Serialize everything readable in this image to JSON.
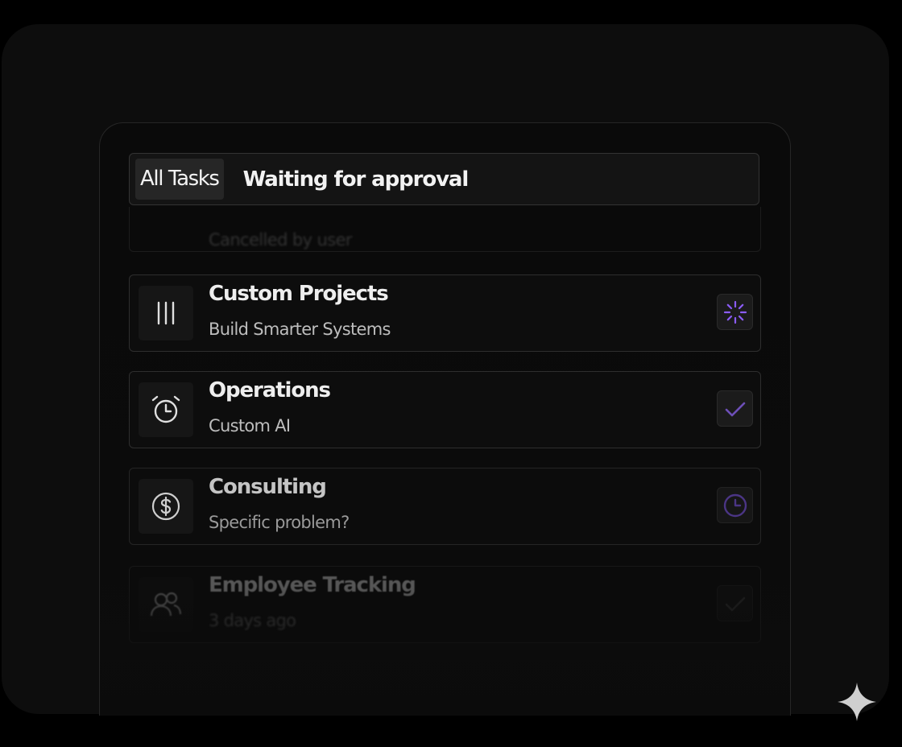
{
  "tabs": {
    "all_label": "All Tasks",
    "waiting_label": "Waiting for approval"
  },
  "ghost_card": {
    "subtitle": "Cancelled by user"
  },
  "cards": [
    {
      "title": "Custom Projects",
      "subtitle": "Build Smarter Systems",
      "icon": "columns-icon",
      "status": "loading-spinner-icon"
    },
    {
      "title": "Operations",
      "subtitle": "Custom AI",
      "icon": "alarm-clock-icon",
      "status": "checkmark-icon"
    },
    {
      "title": "Consulting",
      "subtitle": "Specific problem?",
      "icon": "dollar-circle-icon",
      "status": "clock-icon"
    },
    {
      "title": "Employee Tracking",
      "subtitle": "3 days ago",
      "icon": "users-icon",
      "status": "checkmark-icon"
    }
  ],
  "colors": {
    "accent": "#8b5cf6",
    "accent_dim": "#5b3d9a",
    "background": "#000000",
    "panel": "#0b0b0b"
  }
}
